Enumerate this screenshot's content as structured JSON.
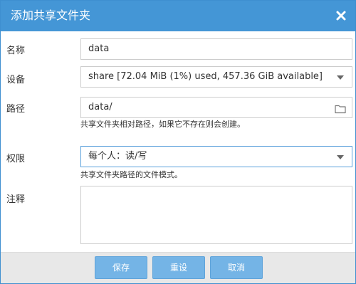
{
  "dialog": {
    "title": "添加共享文件夹",
    "close_icon": "close-icon"
  },
  "form": {
    "name": {
      "label": "名称",
      "value": "data"
    },
    "device": {
      "label": "设备",
      "value": "share [72.04 MiB (1%) used, 457.36 GiB available]"
    },
    "path": {
      "label": "路径",
      "value": "data/",
      "hint": "共享文件夹相对路径，如果它不存在则会创建。",
      "icon": "folder-icon"
    },
    "permissions": {
      "label": "权限",
      "value": "每个人：读/写",
      "hint": "共享文件夹路径的文件模式。"
    },
    "comment": {
      "label": "注释",
      "value": ""
    }
  },
  "buttons": {
    "save": "保存",
    "reset": "重设",
    "cancel": "取消"
  },
  "colors": {
    "titlebar": "#4496d6",
    "button": "#74b4e6",
    "footer": "#e8e8e8"
  }
}
